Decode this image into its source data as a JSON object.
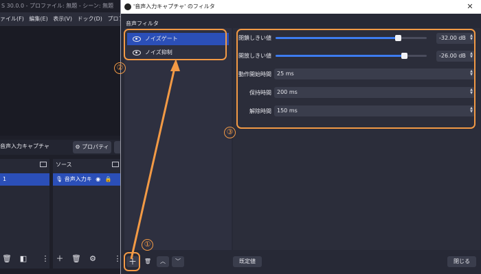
{
  "main_window": {
    "title": "S 30.0.0 - プロファイル: 無題 - シーン: 無題",
    "menu": [
      "ァイル(F)",
      "編集(E)",
      "表示(V)",
      "ドック(D)",
      "プロファイル(P)"
    ],
    "source_name": "音声入力キャプチャ",
    "properties_label": "プロパティ",
    "scene_item": "1",
    "sources_header": "ソース",
    "source_item": "音声入力キ"
  },
  "dialog": {
    "title": "'音声入力キャプチャ' のフィルタ",
    "close_glyph": "✕",
    "section_label": "音声フィルタ",
    "filters": [
      {
        "label": "ノイズゲート",
        "selected": true
      },
      {
        "label": "ノイズ抑制",
        "selected": false
      }
    ],
    "settings": {
      "close_threshold": {
        "label": "閉鎖しきい値",
        "value": "-32.00 dB",
        "level": 0.81
      },
      "open_threshold": {
        "label": "開放しきい値",
        "value": "-26.00 dB",
        "level": 0.85
      },
      "attack": {
        "label": "動作開始時間",
        "value": "25 ms"
      },
      "hold": {
        "label": "保持時間",
        "value": "200 ms"
      },
      "release": {
        "label": "解除時間",
        "value": "150 ms"
      }
    },
    "defaults_label": "既定値",
    "close_label": "閉じる"
  },
  "annotations": {
    "n1": "①",
    "n2": "②",
    "n3": "③"
  },
  "colors": {
    "accent": "#f39a45",
    "selection": "#2b4fb8",
    "slider": "#3d7cf0"
  }
}
